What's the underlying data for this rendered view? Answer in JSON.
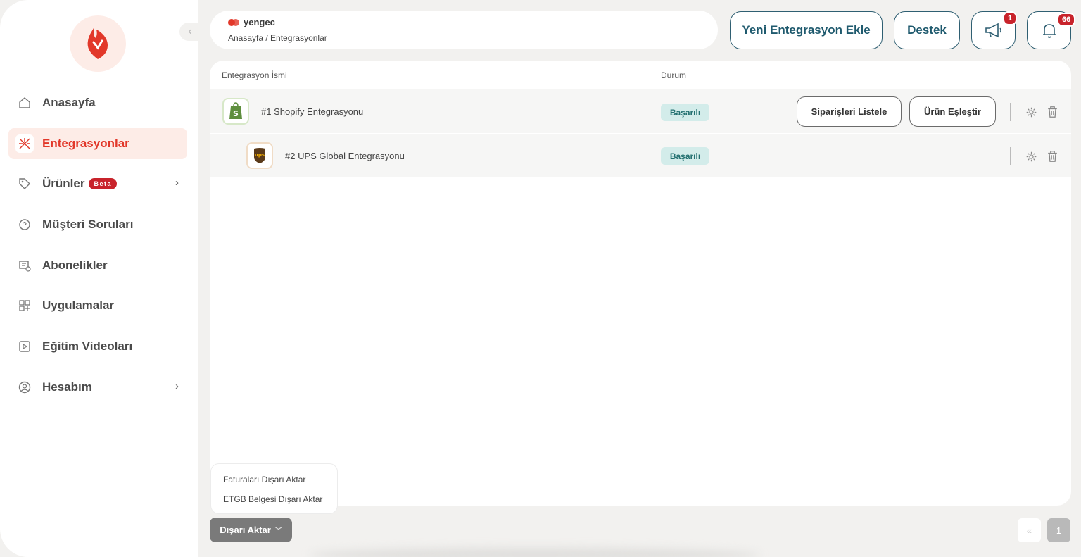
{
  "brand": {
    "name": "yengec",
    "accent": "#e2382a"
  },
  "breadcrumb": "Anasayfa / Entegrasyonlar",
  "header": {
    "add_integration": "Yeni Entegrasyon Ekle",
    "support": "Destek",
    "announcement_count": "1",
    "notification_count": "66"
  },
  "sidebar": {
    "items": [
      {
        "label": "Anasayfa",
        "icon": "home-icon",
        "active": false
      },
      {
        "label": "Entegrasyonlar",
        "icon": "integrations-icon",
        "active": true
      },
      {
        "label": "Ürünler",
        "icon": "tag-icon",
        "badge": "Beta",
        "has_submenu": true
      },
      {
        "label": "Müşteri Soruları",
        "icon": "chat-icon"
      },
      {
        "label": "Abonelikler",
        "icon": "subscription-icon"
      },
      {
        "label": "Uygulamalar",
        "icon": "apps-icon"
      },
      {
        "label": "Eğitim Videoları",
        "icon": "video-icon"
      },
      {
        "label": "Hesabım",
        "icon": "account-icon",
        "has_submenu": true
      }
    ]
  },
  "table": {
    "headers": {
      "name": "Entegrasyon İsmi",
      "status": "Durum"
    },
    "rows": [
      {
        "name": "#1 Shopify Entegrasyonu",
        "status": "Başarılı",
        "logo": "shopify-logo",
        "actions": {
          "list_orders": "Siparişleri Listele",
          "match_products": "Ürün Eşleştir"
        }
      },
      {
        "name": "#2 UPS Global Entegrasyonu",
        "status": "Başarılı",
        "logo": "ups-logo",
        "logo_text": "ups"
      }
    ]
  },
  "export": {
    "button": "Dışarı Aktar",
    "options": [
      "Faturaları Dışarı Aktar",
      "ETGB Belgesi Dışarı Aktar"
    ]
  },
  "pagination": {
    "prev": "«",
    "current": "1"
  }
}
